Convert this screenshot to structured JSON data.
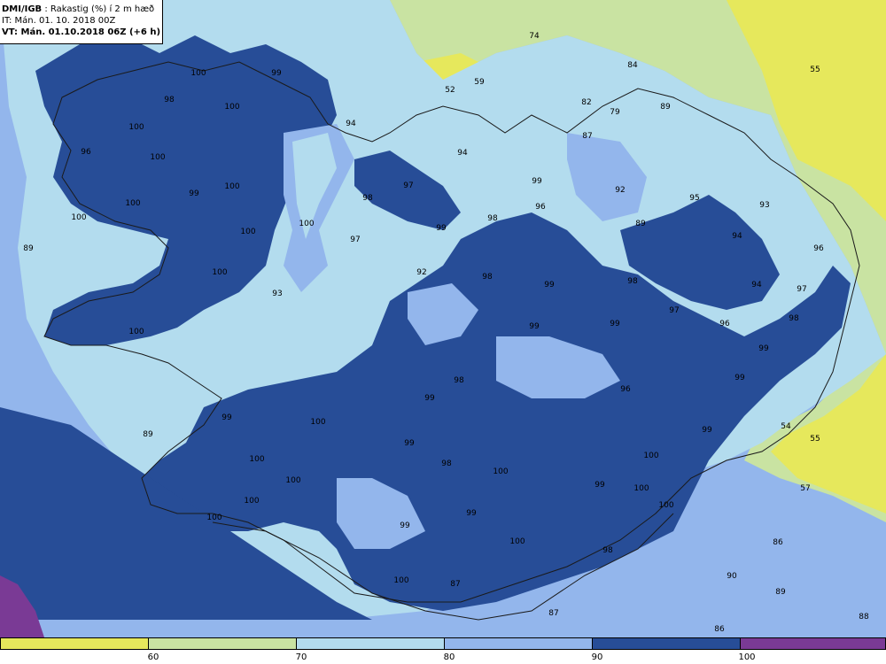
{
  "header": {
    "org": "DMI/IGB",
    "param": ": Rakastig (%) í 2 m hæð",
    "issue": "IT: Mán. 01. 10. 2018 00Z",
    "valid": "VT: Mán. 01.10.2018 06Z (+6 h)"
  },
  "colors": {
    "c50": "#e6e85c",
    "c60": "#c9e3a2",
    "c70": "#b3dcee",
    "c80": "#93b6ec",
    "c90": "#274d97",
    "c100": "#7a3a95",
    "coast": "#1a1a1a"
  },
  "legend": {
    "ticks": [
      "60",
      "70",
      "80",
      "90",
      "100"
    ]
  },
  "values": [
    {
      "t": "74"
    },
    {
      "t": "84"
    },
    {
      "t": "55"
    },
    {
      "t": "52"
    },
    {
      "t": "59"
    },
    {
      "t": "82"
    },
    {
      "t": "79"
    },
    {
      "t": "89"
    },
    {
      "t": "100"
    },
    {
      "t": "99"
    },
    {
      "t": "98"
    },
    {
      "t": "100"
    },
    {
      "t": "94"
    },
    {
      "t": "100"
    },
    {
      "t": "96"
    },
    {
      "t": "100"
    },
    {
      "t": "94"
    },
    {
      "t": "87"
    },
    {
      "t": "99"
    },
    {
      "t": "92"
    },
    {
      "t": "99"
    },
    {
      "t": "100"
    },
    {
      "t": "98"
    },
    {
      "t": "97"
    },
    {
      "t": "96"
    },
    {
      "t": "98"
    },
    {
      "t": "95"
    },
    {
      "t": "93"
    },
    {
      "t": "89"
    },
    {
      "t": "100"
    },
    {
      "t": "100"
    },
    {
      "t": "99"
    },
    {
      "t": "94"
    },
    {
      "t": "96"
    },
    {
      "t": "89"
    },
    {
      "t": "97"
    },
    {
      "t": "100"
    },
    {
      "t": "92"
    },
    {
      "t": "98"
    },
    {
      "t": "99"
    },
    {
      "t": "98"
    },
    {
      "t": "94"
    },
    {
      "t": "97"
    },
    {
      "t": "93"
    },
    {
      "t": "100"
    },
    {
      "t": "100"
    },
    {
      "t": "100"
    },
    {
      "t": "99"
    },
    {
      "t": "97"
    },
    {
      "t": "96"
    },
    {
      "t": "98"
    },
    {
      "t": "99"
    },
    {
      "t": "99"
    },
    {
      "t": "98"
    },
    {
      "t": "99"
    },
    {
      "t": "96"
    },
    {
      "t": "99"
    },
    {
      "t": "99"
    },
    {
      "t": "89"
    },
    {
      "t": "100"
    },
    {
      "t": "99"
    },
    {
      "t": "99"
    },
    {
      "t": "54"
    },
    {
      "t": "55"
    },
    {
      "t": "100"
    },
    {
      "t": "98"
    },
    {
      "t": "100"
    },
    {
      "t": "100"
    },
    {
      "t": "100"
    },
    {
      "t": "99"
    },
    {
      "t": "100"
    },
    {
      "t": "57"
    },
    {
      "t": "100"
    },
    {
      "t": "100"
    },
    {
      "t": "99"
    },
    {
      "t": "99"
    },
    {
      "t": "100"
    },
    {
      "t": "86"
    },
    {
      "t": "98"
    },
    {
      "t": "90"
    },
    {
      "t": "100"
    },
    {
      "t": "100"
    },
    {
      "t": "89"
    },
    {
      "t": "87"
    },
    {
      "t": "88"
    },
    {
      "t": "86"
    },
    {
      "t": "87"
    }
  ]
}
